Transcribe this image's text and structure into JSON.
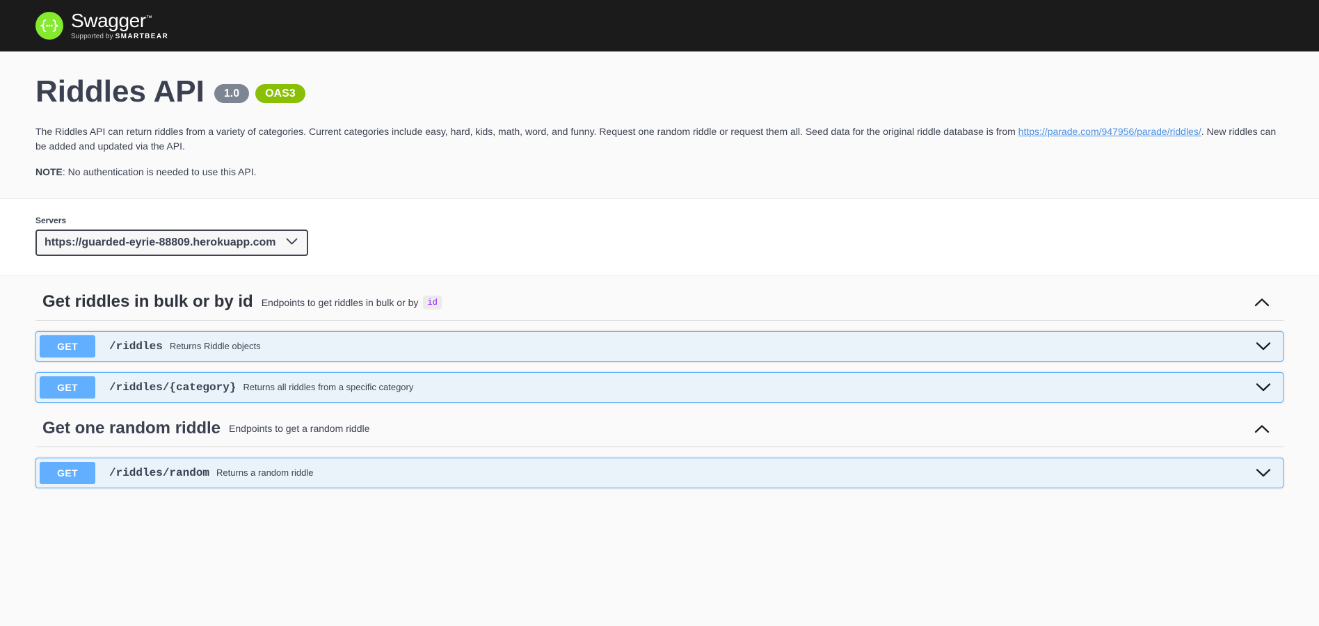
{
  "topbar": {
    "logo_icon": "swagger-braces-logo",
    "brand": "Swagger",
    "trademark": "™",
    "supported_prefix": "Supported by",
    "supported_brand": "SMARTBEAR"
  },
  "info": {
    "title": "Riddles API",
    "version_badge": "1.0",
    "spec_badge": "OAS3",
    "description_part1": "The Riddles API can return riddles from a variety of categories. Current categories include easy, hard, kids, math, word, and funny. Request one random riddle or request them all. Seed data for the original riddle database is from ",
    "description_link": "https://parade.com/947956/parade/riddles/",
    "description_part2": ". New riddles can be added and updated via the API.",
    "note_label": "NOTE",
    "note_text": ": No authentication is needed to use this API."
  },
  "servers": {
    "label": "Servers",
    "selected": "https://guarded-eyrie-88809.herokuapp.com",
    "options": [
      "https://guarded-eyrie-88809.herokuapp.com"
    ],
    "chevron_icon": "chevron-down-icon"
  },
  "sections": [
    {
      "name": "Get riddles in bulk or by id",
      "desc_text": "Endpoints to get riddles in bulk or by",
      "desc_code": "id",
      "expanded": true,
      "toggle_icon": "chevron-up-icon",
      "operations": [
        {
          "method": "GET",
          "path": "/riddles",
          "summary": "Returns Riddle objects",
          "toggle_icon": "chevron-down-icon"
        },
        {
          "method": "GET",
          "path": "/riddles/{category}",
          "summary": "Returns all riddles from a specific category",
          "toggle_icon": "chevron-down-icon"
        }
      ]
    },
    {
      "name": "Get one random riddle",
      "desc_text": "Endpoints to get a random riddle",
      "desc_code": "",
      "expanded": true,
      "toggle_icon": "chevron-up-icon",
      "operations": [
        {
          "method": "GET",
          "path": "/riddles/random",
          "summary": "Returns a random riddle",
          "toggle_icon": "chevron-down-icon"
        }
      ]
    }
  ],
  "colors": {
    "topbar_bg": "#1b1b1b",
    "logo_green": "#85ea2d",
    "get_blue": "#61affe",
    "op_row_bg": "#ebf3fa",
    "oas_green": "#89bf04",
    "version_gray": "#7d8492",
    "link_blue": "#4990e2",
    "text_dark": "#3b4151",
    "code_purple": "#9012fe"
  }
}
